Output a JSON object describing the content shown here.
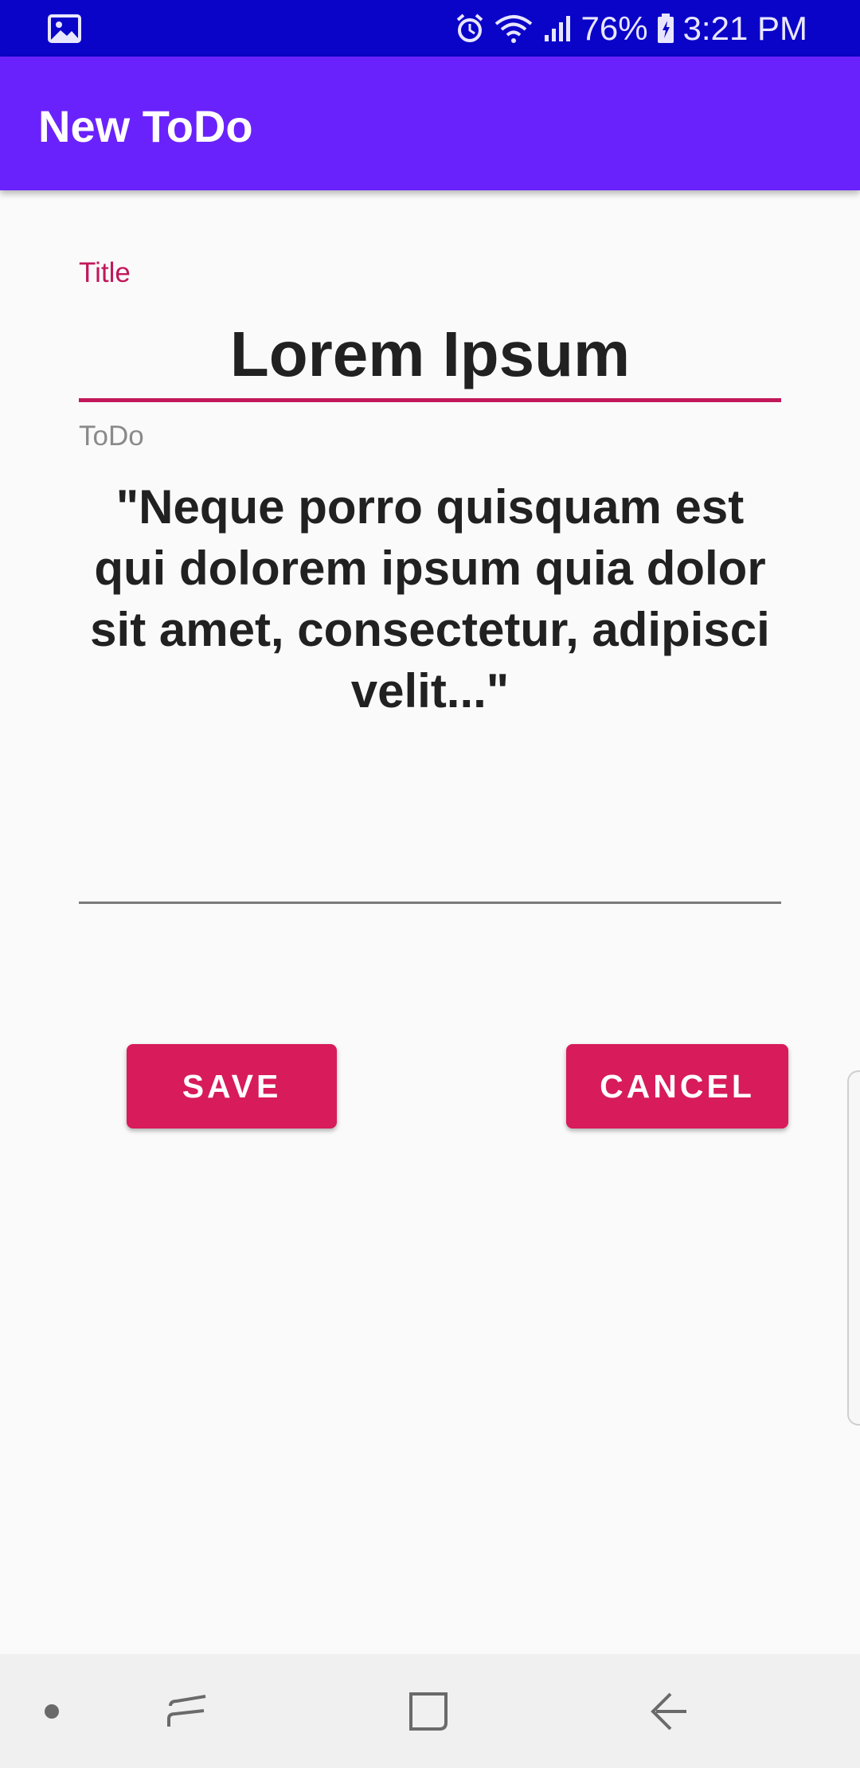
{
  "status_bar": {
    "battery": "76%",
    "time": "3:21 PM",
    "icons": [
      "gallery-icon",
      "alarm-icon",
      "wifi-icon",
      "signal-icon",
      "battery-icon"
    ]
  },
  "app_bar": {
    "title": "New ToDo"
  },
  "form": {
    "title_label": "Title",
    "title_value": "Lorem Ipsum",
    "todo_label": "ToDo",
    "todo_value": "\"Neque porro quisquam est qui dolorem ipsum quia dolor sit amet, consectetur, adipisci velit...\""
  },
  "buttons": {
    "save_label": "SAVE",
    "cancel_label": "CANCEL"
  },
  "nav_bar": {
    "icons": [
      "dot-icon",
      "recents-icon",
      "home-icon",
      "back-icon"
    ]
  },
  "colors": {
    "status_bar": "#0a04c8",
    "app_bar": "#6a22fc",
    "accent": "#c2185b",
    "button": "#d81b5a"
  }
}
